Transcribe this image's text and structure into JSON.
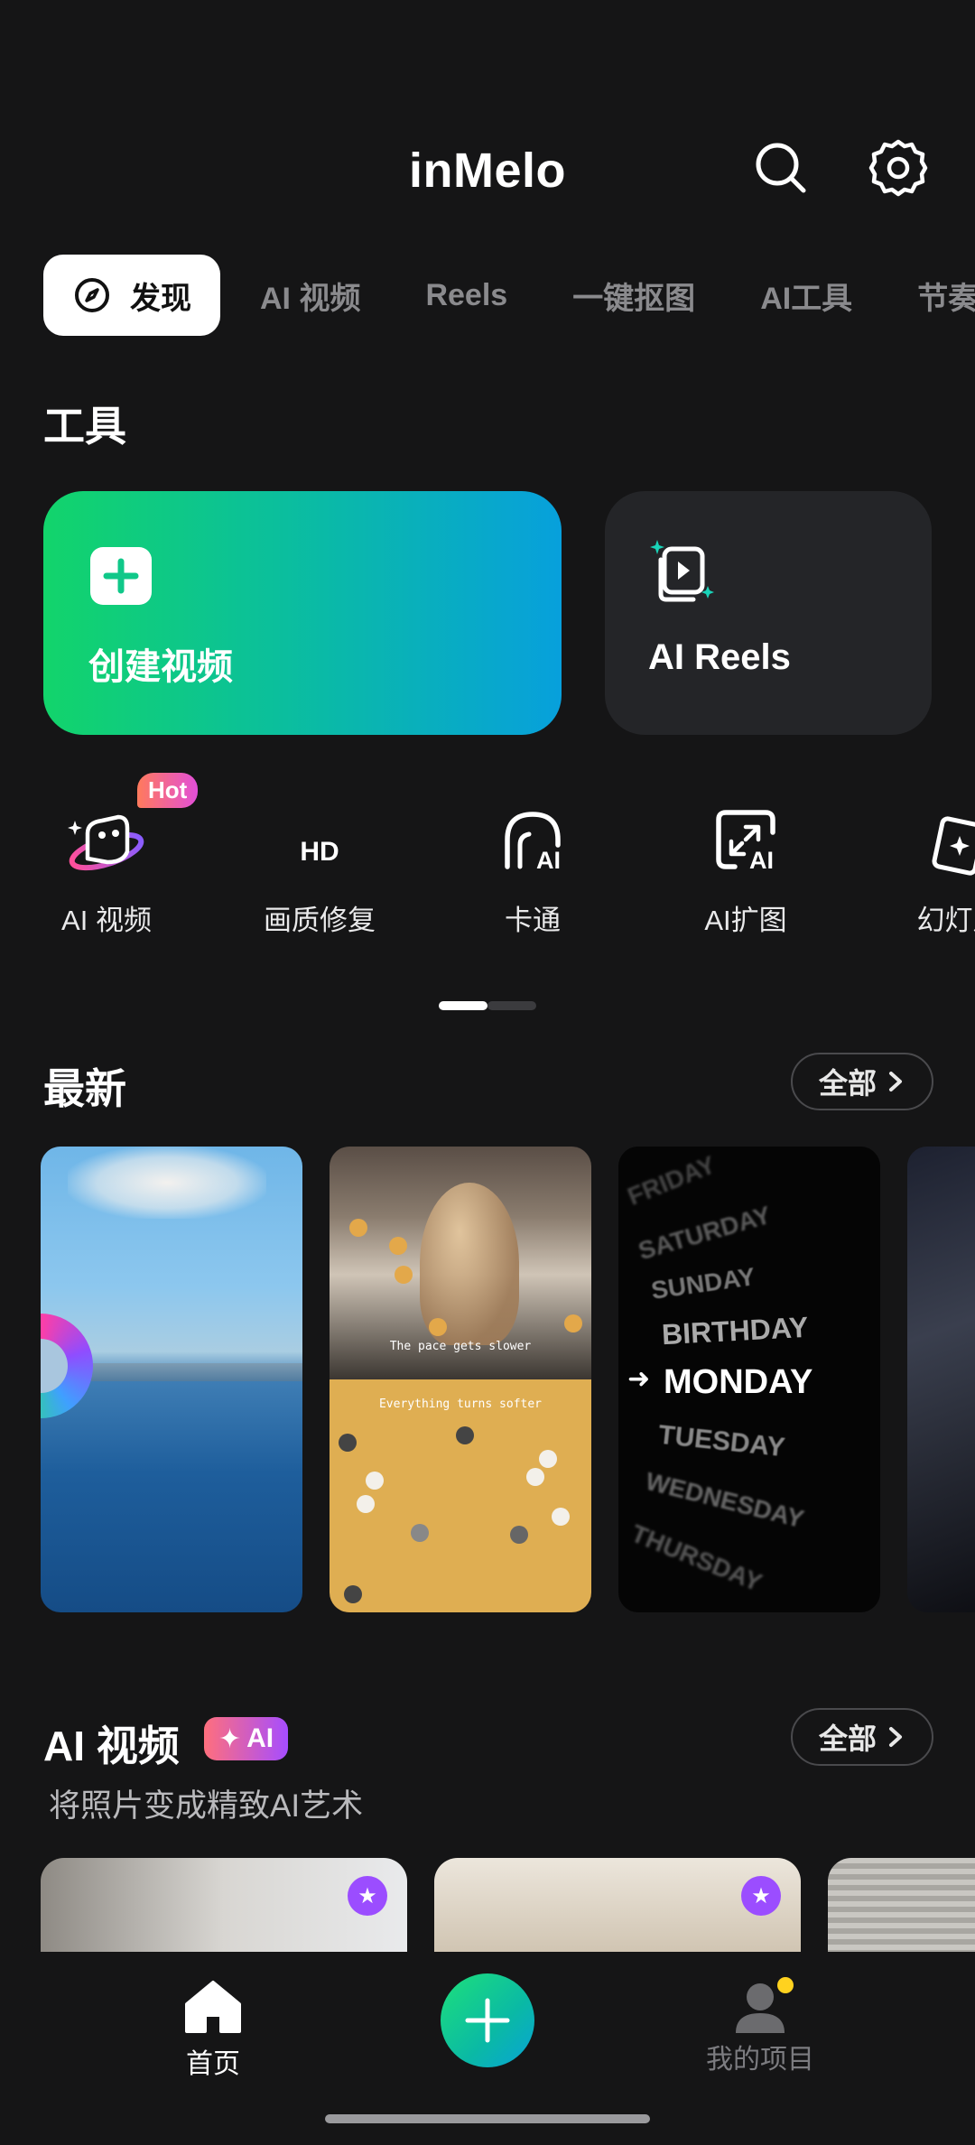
{
  "header": {
    "title": "inMelo"
  },
  "tabs": [
    {
      "label": "发现",
      "active": true
    },
    {
      "label": "AI 视频"
    },
    {
      "label": "Reels"
    },
    {
      "label": "一键抠图"
    },
    {
      "label": "AI工具"
    },
    {
      "label": "节奏"
    }
  ],
  "tools_section": {
    "title": "工具",
    "create_label": "创建视频",
    "reels_label": "AI Reels",
    "items": [
      {
        "label": "AI 视频",
        "icon": "ai-video-icon",
        "badge": "Hot"
      },
      {
        "label": "画质修复",
        "icon": "hd-icon",
        "icon_text": "HD"
      },
      {
        "label": "卡通",
        "icon": "cartoon-icon",
        "icon_text": "AI"
      },
      {
        "label": "AI扩图",
        "icon": "expand-icon",
        "icon_text": "AI"
      },
      {
        "label": "幻灯片",
        "icon": "slideshow-icon"
      }
    ]
  },
  "latest_section": {
    "title": "最新",
    "all_label": "全部",
    "thumb2_text1": "The pace gets slower",
    "thumb2_text2": "Everything turns softer",
    "days": [
      "FRIDAY",
      "SATURDAY",
      "SUNDAY",
      "BIRTHDAY",
      "MONDAY",
      "TUESDAY",
      "WEDNESDAY",
      "THURSDAY"
    ]
  },
  "ai_video_section": {
    "title": "AI 视频",
    "badge": "AI",
    "subtitle": "将照片变成精致AI艺术",
    "all_label": "全部"
  },
  "bottom_nav": {
    "home_label": "首页",
    "projects_label": "我的项目"
  },
  "colors": {
    "background": "#151516",
    "accent_green": "#12d46b",
    "accent_blue": "#07a0dc",
    "notification_dot": "#ffd21f"
  }
}
